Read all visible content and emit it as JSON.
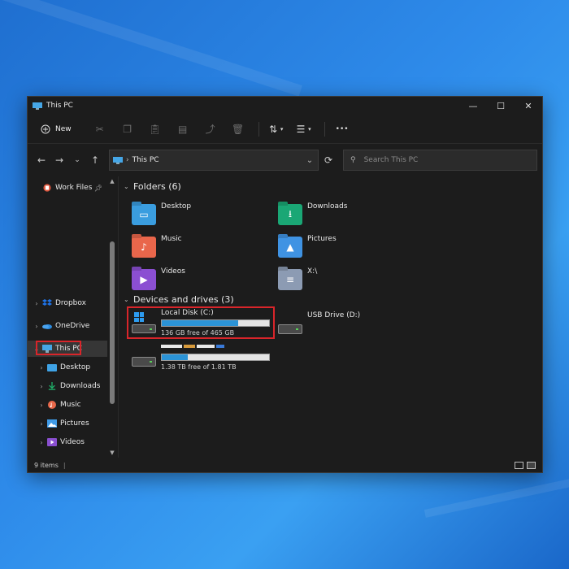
{
  "window": {
    "title": "This PC",
    "controls": {
      "minimize": "—",
      "maximize": "☐",
      "close": "✕"
    }
  },
  "toolbar": {
    "new_label": "New",
    "sort_glyph": "⇅",
    "view_glyph": "☰",
    "more_glyph": "•••"
  },
  "address": {
    "path": "This PC",
    "search_placeholder": "Search This PC"
  },
  "sidebar": {
    "items": [
      {
        "label": "Work Files",
        "icon": "work-files-icon",
        "color": "#e0573e",
        "pinned": true
      },
      {
        "label": "Dropbox",
        "icon": "dropbox-icon",
        "color": "#1e73e8"
      },
      {
        "label": "OneDrive",
        "icon": "onedrive-icon",
        "color": "#2b8be0"
      },
      {
        "label": "This PC",
        "icon": "computer-icon",
        "color": "#45a6e6",
        "selected": true
      },
      {
        "label": "Desktop",
        "icon": "desktop-folder-icon",
        "color": "#3fa3e6"
      },
      {
        "label": "Downloads",
        "icon": "download-icon",
        "color": "#1fb56c"
      },
      {
        "label": "Music",
        "icon": "music-icon",
        "color": "#e8684a"
      },
      {
        "label": "Pictures",
        "icon": "pictures-icon",
        "color": "#3f9be8"
      },
      {
        "label": "Videos",
        "icon": "videos-icon",
        "color": "#8a4fd0"
      }
    ]
  },
  "folders": {
    "header": "Folders (6)",
    "items": [
      {
        "label": "Desktop",
        "color": "#3a9ddf",
        "glyph": "▭"
      },
      {
        "label": "Downloads",
        "color": "#1aa775",
        "glyph": "⭳"
      },
      {
        "label": "Music",
        "color": "#e9664b",
        "glyph": "♪"
      },
      {
        "label": "Pictures",
        "color": "#3f93e3",
        "glyph": "▲"
      },
      {
        "label": "Videos",
        "color": "#8b4fd2",
        "glyph": "▶"
      },
      {
        "label": "X:\\",
        "color": "#8c9bb3",
        "glyph": "≡"
      }
    ]
  },
  "drives": {
    "header": "Devices and drives (3)",
    "items": [
      {
        "label": "Local Disk (C:)",
        "free": "136 GB free of 465 GB",
        "used_fraction": 0.71
      },
      {
        "label": "USB Drive (D:)"
      },
      {
        "label": "",
        "free": "1.38 TB free of 1.81 TB",
        "used_fraction": 0.24
      }
    ]
  },
  "status": {
    "items": "9 items"
  }
}
